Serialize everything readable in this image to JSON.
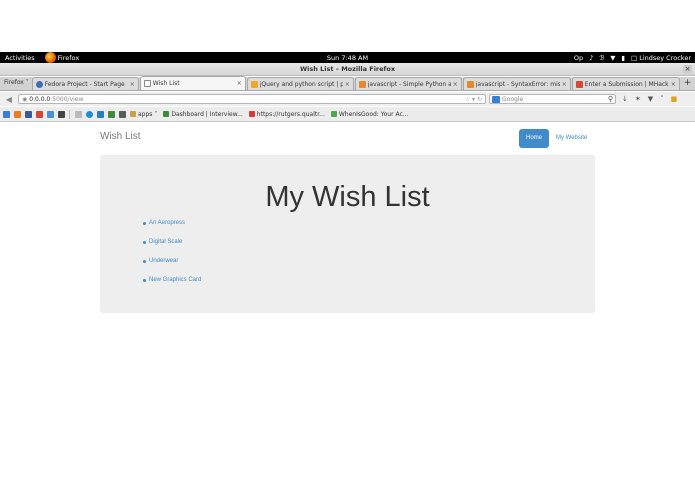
{
  "system_bar": {
    "activities": "Activities",
    "app_name": "Firefox",
    "clock": "Sun  7:48 AM",
    "op": "Op",
    "user": "Lindsey Crocker"
  },
  "window": {
    "title": "Wish List – Mozilla Firefox",
    "close": "×"
  },
  "tabs": {
    "firefox_menu": "Firefox ˅",
    "new_tab": "+",
    "items": [
      {
        "title": "Fedora Project - Start Page",
        "color": "#3c6eb4",
        "close": "×"
      },
      {
        "title": "Wish List",
        "color": "#ffffff",
        "close": "×"
      },
      {
        "title": "jQuery and python script | p...",
        "color": "#f4a62a",
        "close": "×"
      },
      {
        "title": "javascript - Simple Python a...",
        "color": "#e48a2c",
        "close": "×"
      },
      {
        "title": "javascript - SyntaxError: mis...",
        "color": "#e48a2c",
        "close": "×"
      },
      {
        "title": "Enter a Submission | MHack...",
        "color": "#d64937",
        "close": "×"
      }
    ]
  },
  "navbar": {
    "url_host": "0.0.0.0",
    "url_path": ":5000/view",
    "url_controls": "☆ ▾ ↻",
    "search_placeholder": "Google"
  },
  "bookmarks": {
    "items": [
      {
        "label": "apps ˅",
        "color": "#c8a24a"
      },
      {
        "label": "Dashboard | Interview...",
        "color": "#3a8b3a"
      },
      {
        "label": "https://rutgers.qualtr...",
        "color": "#d23c3c"
      },
      {
        "label": "WhenIsGood: Your Ac...",
        "color": "#4fa84f"
      }
    ]
  },
  "page": {
    "brand": "Wish List",
    "nav_home": "Home",
    "nav_site": "My Website",
    "heading": "My Wish List",
    "items": [
      "An Aeropress",
      "Digital Scale",
      "Underwear",
      "New Graphics Card"
    ]
  }
}
